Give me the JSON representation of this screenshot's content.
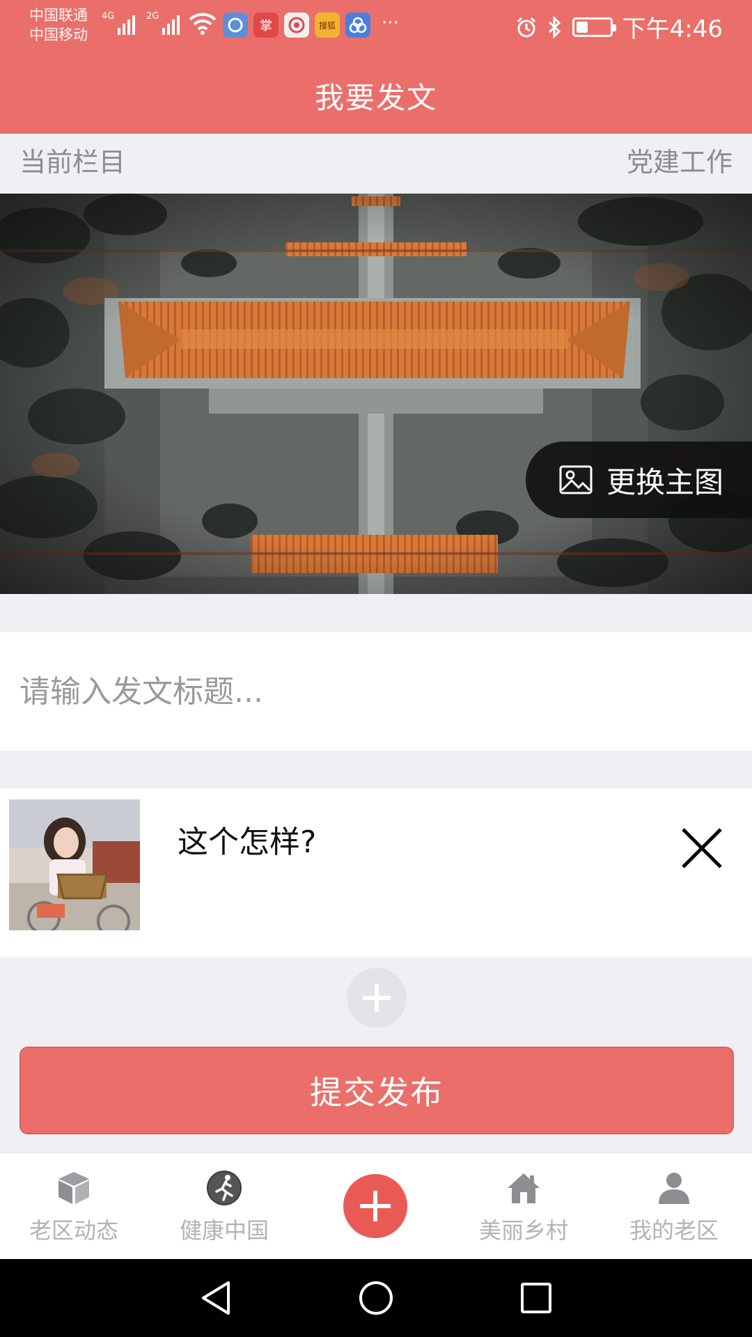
{
  "status_bar": {
    "carrier_1": "中国联通",
    "carrier_2": "中国移动",
    "network_1": "4G",
    "network_2": "2G",
    "more": "···",
    "time": "下午4:46",
    "battery_level": 0.35,
    "app_icons": [
      {
        "name": "browser-icon",
        "color": "#5b8fd8"
      },
      {
        "name": "zhang-app-icon",
        "glyph": "掌",
        "color": "#e04848"
      },
      {
        "name": "weibo-icon",
        "color": "#f0f0f0"
      },
      {
        "name": "sohu-news-icon",
        "glyph": "搜狐",
        "color": "#f2b430"
      },
      {
        "name": "link-app-icon",
        "color": "#4a7fe0"
      }
    ]
  },
  "header": {
    "title": "我要发文"
  },
  "column": {
    "label": "当前栏目",
    "value": "党建工作"
  },
  "hero": {
    "change_label": "更换主图"
  },
  "title_input": {
    "placeholder": "请输入发文标题..."
  },
  "content_card": {
    "text": "这个怎样?"
  },
  "submit": {
    "label": "提交发布"
  },
  "tabbar": {
    "items": [
      {
        "label": "老区动态",
        "icon": "cube-icon"
      },
      {
        "label": "健康中国",
        "icon": "runner-icon"
      },
      {
        "label": "",
        "icon": "plus-icon"
      },
      {
        "label": "美丽乡村",
        "icon": "house-icon"
      },
      {
        "label": "我的老区",
        "icon": "person-icon"
      }
    ]
  },
  "colors": {
    "brand": "#ea6f6a",
    "background": "#efeff4",
    "tab_label": "#b3b3b3"
  }
}
